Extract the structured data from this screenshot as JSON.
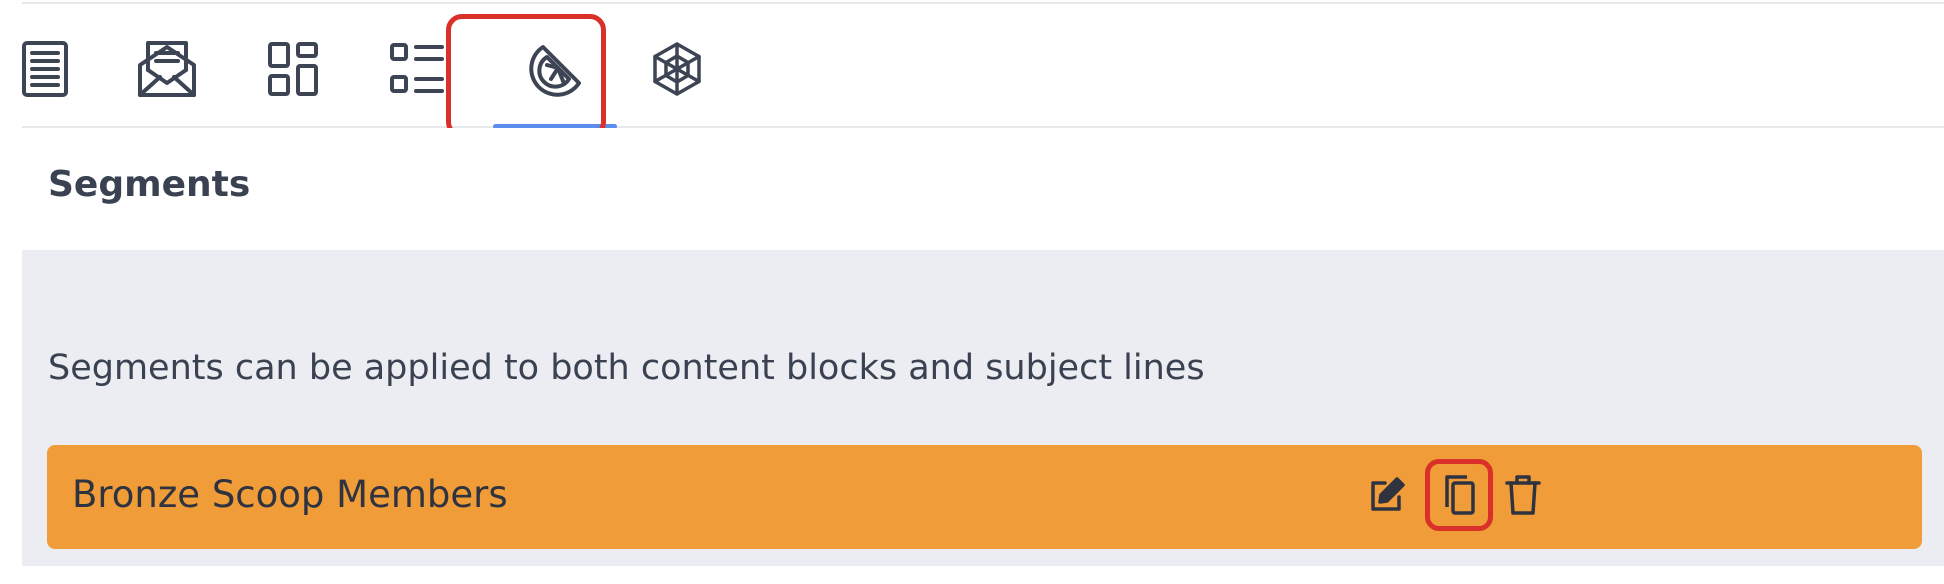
{
  "toolbar": {
    "tabs": [
      {
        "name": "page",
        "icon": "document-icon",
        "active": false
      },
      {
        "name": "email",
        "icon": "envelope-icon",
        "active": false
      },
      {
        "name": "layout",
        "icon": "grid-layout-icon",
        "active": false
      },
      {
        "name": "list",
        "icon": "list-icon",
        "active": false
      },
      {
        "name": "segments",
        "icon": "citrus-slice-icon",
        "active": true
      },
      {
        "name": "network",
        "icon": "network-icon",
        "active": false
      }
    ],
    "accent_color": "#5b8def",
    "highlight_color": "#d9302a"
  },
  "segments": {
    "title": "Segments",
    "description": "Segments can be applied to both content blocks and subject lines",
    "items": [
      {
        "label": "Bronze Scoop Members",
        "color": "#f09c38",
        "actions": [
          "edit-icon",
          "copy-icon",
          "trash-icon"
        ]
      }
    ]
  }
}
